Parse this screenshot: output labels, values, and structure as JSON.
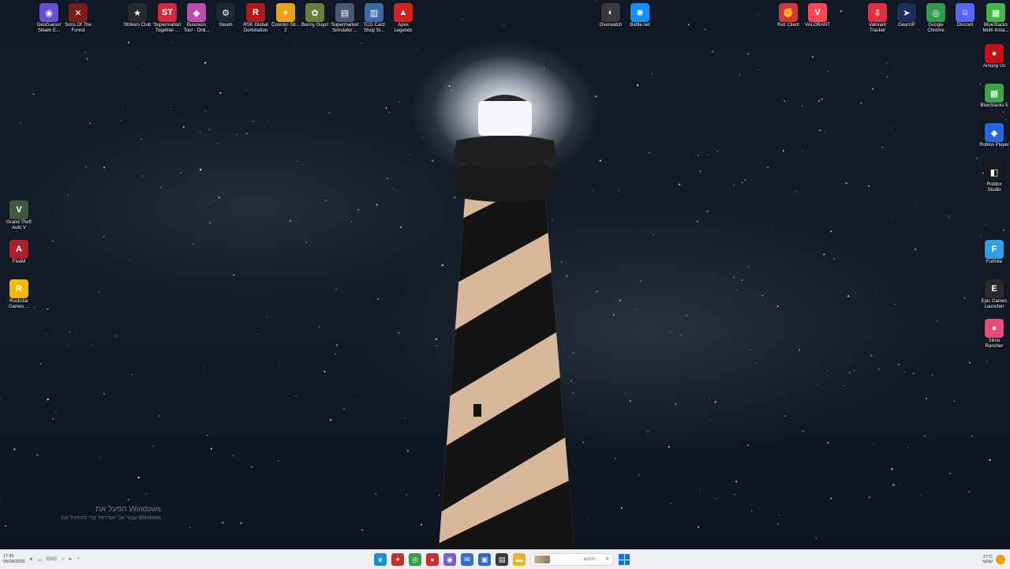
{
  "desktop": {
    "icons_top": [
      {
        "name": "geoguessr",
        "label": "GeoGuessr\nSteam E...",
        "icon": "map-pin-icon",
        "color": "#6a4fd6",
        "glyph": "◉"
      },
      {
        "name": "sons-of-the-forest",
        "label": "Sons Of The\nForest",
        "icon": "forest-icon",
        "color": "#7a1d1d",
        "glyph": "✕"
      },
      {
        "name": "strikers-club",
        "label": "Strikers Club",
        "icon": "shield-icon",
        "color": "#2a2a2a",
        "glyph": "★"
      },
      {
        "name": "supermarket-together",
        "label": "Supermarket\nTogether ...",
        "icon": "supermarket-icon",
        "color": "#d32b3b",
        "glyph": "ST"
      },
      {
        "name": "business-tour",
        "label": "Business\nTour - Onli...",
        "icon": "dice-icon",
        "color": "#c04bb0",
        "glyph": "◆"
      },
      {
        "name": "steam",
        "label": "Steam",
        "icon": "steam-icon",
        "color": "#1b2838",
        "glyph": "⚙"
      },
      {
        "name": "rsk-global-domination",
        "label": "RSK Global\nDomination",
        "icon": "rsk-icon",
        "color": "#b11b1b",
        "glyph": "R"
      },
      {
        "name": "counter-strike-2",
        "label": "Counter-Str...\n2",
        "icon": "cs2-icon",
        "color": "#e8a21a",
        "glyph": "✦"
      },
      {
        "name": "bunny-guys",
        "label": "Bunny Guys!",
        "icon": "bunny-icon",
        "color": "#6b7d3a",
        "glyph": "✿"
      },
      {
        "name": "supermarket-simulator",
        "label": "Supermarket\nSimulator ...",
        "icon": "store-icon",
        "color": "#4a5a72",
        "glyph": "▤"
      },
      {
        "name": "tcg-card-shop",
        "label": "TCG Card\nShop Si...",
        "icon": "cards-icon",
        "color": "#3a6aa8",
        "glyph": "▥"
      },
      {
        "name": "apex-legends",
        "label": "Apex\nLegends",
        "icon": "apex-icon",
        "color": "#d42222",
        "glyph": "▲"
      },
      {
        "name": "overwatch",
        "label": "Overwatch",
        "icon": "overwatch-icon",
        "color": "#3a3a3a",
        "glyph": "◐"
      },
      {
        "name": "battle-net",
        "label": "Battle.net",
        "icon": "battlenet-icon",
        "color": "#148eff",
        "glyph": "✺"
      },
      {
        "name": "riot-client",
        "label": "Riot Client",
        "icon": "riot-icon",
        "color": "#d13639",
        "glyph": "✊"
      },
      {
        "name": "valorant",
        "label": "VALORANT",
        "icon": "valorant-icon",
        "color": "#ff4655",
        "glyph": "V"
      },
      {
        "name": "valorant-tracker",
        "label": "Valorant\nTracker",
        "icon": "tracker-icon",
        "color": "#e02f3f",
        "glyph": "⇩"
      },
      {
        "name": "gearup",
        "label": "GearUP",
        "icon": "gearup-icon",
        "color": "#1c2e5a",
        "glyph": "➤"
      },
      {
        "name": "google-chrome",
        "label": "Google\nChrome",
        "icon": "chrome-icon",
        "color": "#2f9e4a",
        "glyph": "◎"
      },
      {
        "name": "discord",
        "label": "Discord",
        "icon": "discord-icon",
        "color": "#5865f2",
        "glyph": "☺"
      },
      {
        "name": "bluestacks-multi",
        "label": "BlueStacks\nMulti-Insta...",
        "icon": "bluestacks-icon",
        "color": "#45b649",
        "glyph": "▦"
      }
    ],
    "icons_left": [
      {
        "name": "gta-v",
        "label": "Grand Theft\nAuto V",
        "icon": "gta-icon",
        "color": "#3d5a3d",
        "glyph": "V"
      },
      {
        "name": "fivem",
        "label": "FiveM",
        "icon": "fivem-icon",
        "color": "#b01e2e",
        "glyph": "A"
      },
      {
        "name": "rockstar-games",
        "label": "Rockstar\nGames ...",
        "icon": "rockstar-icon",
        "color": "#f5b800",
        "glyph": "R"
      }
    ],
    "icons_right": [
      {
        "name": "among-us",
        "label": "Among Us",
        "icon": "among-us-icon",
        "color": "#c51111",
        "glyph": "●"
      },
      {
        "name": "bluestacks-5",
        "label": "BlueStacks 5",
        "icon": "bluestacks-icon",
        "color": "#3da34a",
        "glyph": "▦"
      },
      {
        "name": "roblox-player",
        "label": "Roblox Player",
        "icon": "roblox-icon",
        "color": "#2866e0",
        "glyph": "◆"
      },
      {
        "name": "roblox-studio",
        "label": "Roblox\nStudio",
        "icon": "roblox-studio-icon",
        "color": "#1a1a1a",
        "glyph": "◧"
      },
      {
        "name": "fortnite",
        "label": "Fortnite",
        "icon": "fortnite-icon",
        "color": "#2ea0e6",
        "glyph": "F"
      },
      {
        "name": "epic-games",
        "label": "Epic Games\nLauncher",
        "icon": "epic-icon",
        "color": "#2a2a2a",
        "glyph": "E"
      },
      {
        "name": "slime-rancher",
        "label": "Slime\nRancher",
        "icon": "slime-icon",
        "color": "#e84a7a",
        "glyph": "●"
      }
    ]
  },
  "watermark": {
    "line1": "הפעל את Windows",
    "line2": "עבור אל 'הגדרות' כדי להפעיל את Windows"
  },
  "taskbar": {
    "time": "17:45",
    "date": "05/08/2026",
    "lang": "ENG",
    "search_placeholder": "חיפוש",
    "weather_temp": "27°C",
    "weather_desc": "שמשי",
    "apps": [
      {
        "name": "edge",
        "icon": "edge-icon",
        "color": "#1a8fd6",
        "glyph": "e"
      },
      {
        "name": "app-red",
        "icon": "app-icon",
        "color": "#c43030",
        "glyph": "✦"
      },
      {
        "name": "chrome",
        "icon": "chrome-icon",
        "color": "#2f9e4a",
        "glyph": "◎"
      },
      {
        "name": "app-record",
        "icon": "record-icon",
        "color": "#d62a2a",
        "glyph": "●"
      },
      {
        "name": "app-purple",
        "icon": "app-icon",
        "color": "#7a5cd6",
        "glyph": "◉"
      },
      {
        "name": "mail",
        "icon": "mail-icon",
        "color": "#2f6fd6",
        "glyph": "✉"
      },
      {
        "name": "store",
        "icon": "store-icon",
        "color": "#2a6ad0",
        "glyph": "▣"
      },
      {
        "name": "app-dark",
        "icon": "app-icon",
        "color": "#3a3a3a",
        "glyph": "▤"
      },
      {
        "name": "file-explorer",
        "icon": "folder-icon",
        "color": "#e8b528",
        "glyph": "▬"
      }
    ]
  }
}
